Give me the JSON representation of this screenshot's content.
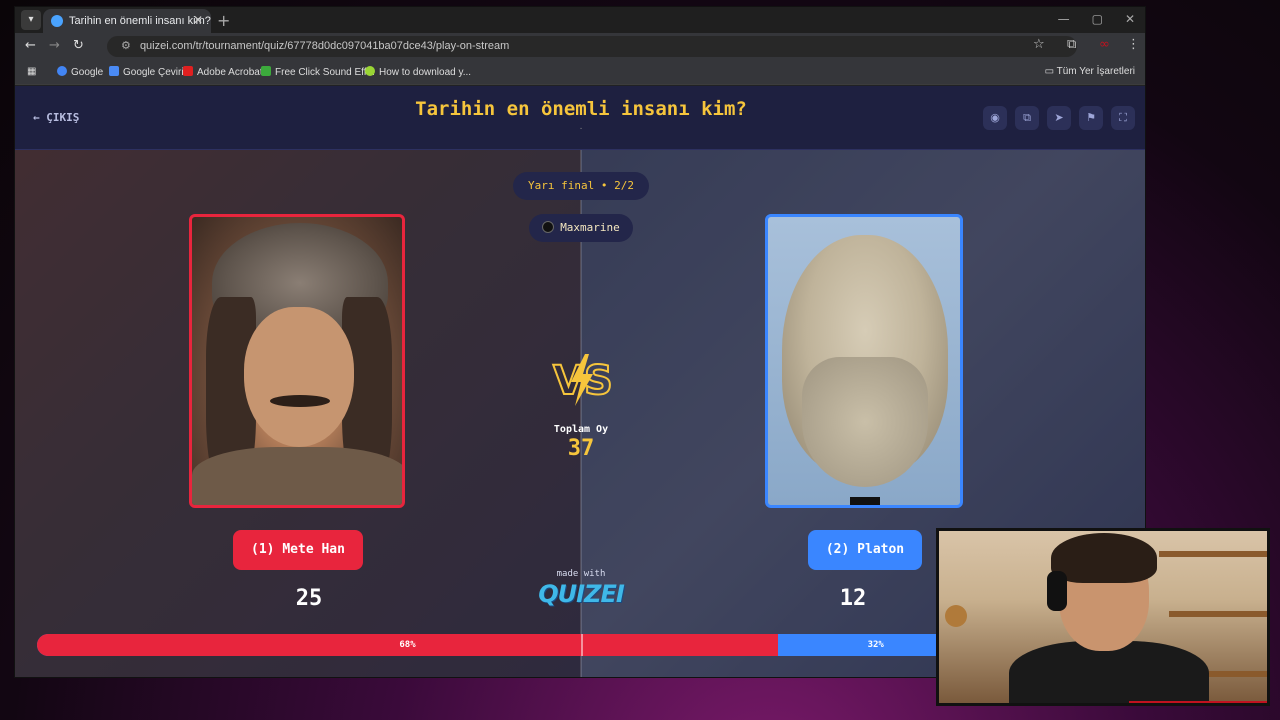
{
  "browser": {
    "tab_title": "Tarihin en önemli insanı kim? - Q",
    "tab_close": "✕",
    "new_tab": "+",
    "url": "quizei.com/tr/tournament/quiz/67778d0dc097041ba07dce43/play-on-stream",
    "bookmarks": [
      "Google",
      "Google Çeviri",
      "Adobe Acrobat",
      "Free Click Sound Eff...",
      "How to download y..."
    ],
    "all_bookmarks": "Tüm Yer İşaretleri"
  },
  "header": {
    "exit_label": "← ÇIKIŞ",
    "title": "Tarihin en önemli insanı kim?",
    "title_dot": "."
  },
  "tournament": {
    "round_label": "Yarı final • 2/2",
    "creator": "Maxmarine",
    "total_label": "Toplam Oy",
    "total_votes": "37",
    "made_with": "made with",
    "brand": "QUIZEI"
  },
  "left": {
    "name": "(1) Mete Han",
    "votes": "25",
    "percent_label": "68%",
    "share": 0.68,
    "color": "#e8253d"
  },
  "right": {
    "name": "(2) Platon",
    "votes": "12",
    "percent_label": "32%",
    "share": 0.32,
    "color": "#3a86ff"
  },
  "colors": {
    "accent": "#f6c53c",
    "page_bg": "#1b1e3a"
  }
}
